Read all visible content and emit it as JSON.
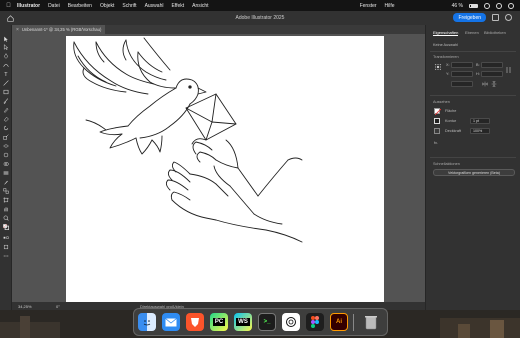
{
  "menubar": {
    "items": [
      "Illustrator",
      "Datei",
      "Bearbeiten",
      "Objekt",
      "Schrift",
      "Auswahl",
      "Effekt",
      "Ansicht"
    ],
    "right_items": [
      "Fenster",
      "Hilfe"
    ],
    "battery": "46 %"
  },
  "appbar": {
    "title": "Adobe Illustrator 2025",
    "share_label": "Freigeben"
  },
  "document": {
    "tab_label": "Unbenannt-1* @ 34,25 % (RGB/Vorschau)",
    "close": "×"
  },
  "status": {
    "zoom": "34,25%",
    "rotation": "0°",
    "tool_label": "Direktauswahl groß/klein"
  },
  "panel": {
    "tabs": [
      "Eigenschaften",
      "Ebenen",
      "Bibliotheken"
    ],
    "no_selection": "Keine Auswahl",
    "transform_heading": "Transformieren",
    "x_label": "X:",
    "y_label": "Y:",
    "w_label": "B:",
    "h_label": "H:",
    "appearance_heading": "Aussehen",
    "fill_label": "Fläche",
    "stroke_label": "Kontur",
    "stroke_value": "1 pt",
    "opacity_label": "Deckkraft",
    "opacity_value": "100%",
    "fx_label": "fx.",
    "quick_actions_heading": "Schnellaktionen",
    "generate_button": "Vektorgrafiken generieren (Beta)"
  },
  "dock": {
    "apps": [
      "Finder",
      "Mail",
      "Brave",
      "PyCharm",
      "WebStorm",
      "Terminal",
      "ChatGPT",
      "Figma",
      "Illustrator",
      "Papierkorb"
    ],
    "labels": {
      "pycharm": "PC",
      "webstorm": "WS",
      "terminal": ">_",
      "illustrator": "Ai"
    }
  },
  "colors": {
    "accent": "#1473e6",
    "artboard": "#ffffff",
    "pasteboard": "#535353",
    "illustrator": "#ff9a00"
  }
}
